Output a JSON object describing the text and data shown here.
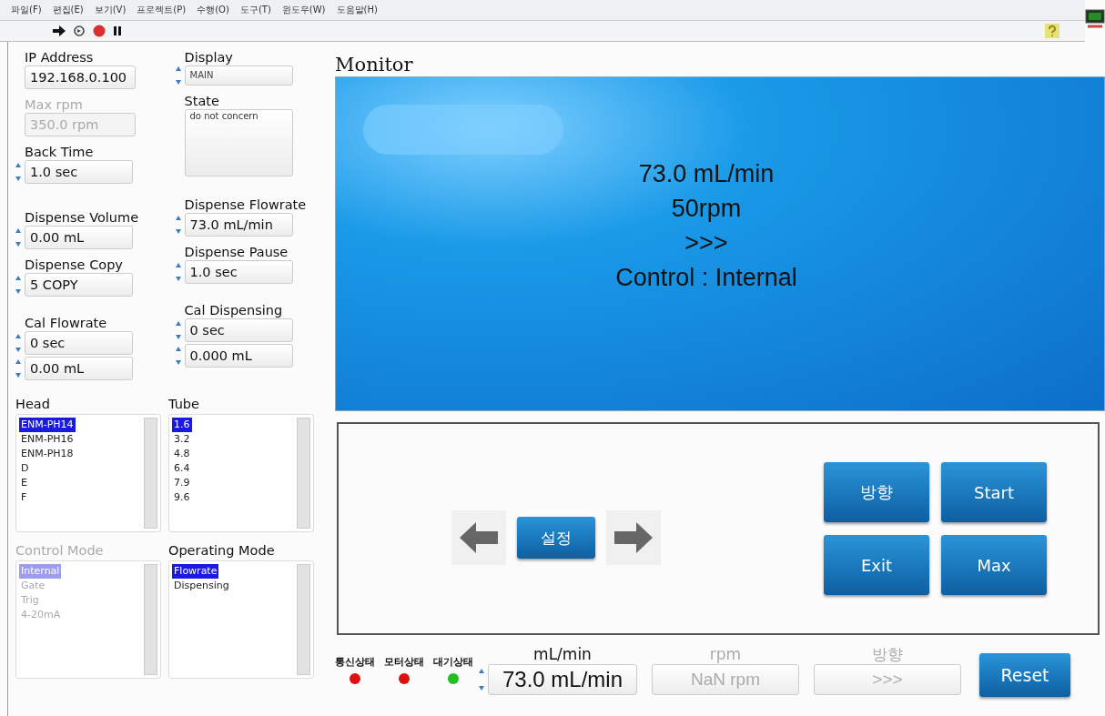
{
  "menu": [
    "파일(F)",
    "편집(E)",
    "보기(V)",
    "프로젝트(P)",
    "수행(O)",
    "도구(T)",
    "윈도우(W)",
    "도움말(H)"
  ],
  "left_column": [
    {
      "label": "IP Address",
      "kind": "text",
      "values": [
        "192.168.0.100"
      ],
      "disabled": false
    },
    {
      "label": "Max rpm",
      "kind": "text",
      "values": [
        "350.0 rpm"
      ],
      "disabled": true
    },
    {
      "label": "Back Time",
      "kind": "spin",
      "values": [
        "1.0 sec"
      ],
      "disabled": false
    },
    {
      "label": "Dispense Volume",
      "kind": "spin",
      "values": [
        "0.00 mL"
      ],
      "disabled": false
    },
    {
      "label": "Dispense Copy",
      "kind": "spin",
      "values": [
        "5 COPY"
      ],
      "disabled": false
    },
    {
      "label": "Cal Flowrate",
      "kind": "spin",
      "values": [
        "0 sec",
        "0.00 mL"
      ],
      "disabled": false
    }
  ],
  "right_column": [
    {
      "label": "Display",
      "kind": "small",
      "values": [
        "MAIN"
      ],
      "disabled": false
    },
    {
      "label": "State",
      "kind": "area",
      "values": [
        "do not concern"
      ],
      "disabled": false
    },
    {
      "label": "Dispense Flowrate",
      "kind": "spin",
      "values": [
        "73.0 mL/min"
      ],
      "disabled": false
    },
    {
      "label": "Dispense Pause",
      "kind": "spin",
      "values": [
        "1.0 sec"
      ],
      "disabled": false
    },
    {
      "label": "Cal Dispensing",
      "kind": "spin",
      "values": [
        "0 sec",
        "0.000 mL"
      ],
      "disabled": false
    }
  ],
  "lists": [
    {
      "label": "Head",
      "disabled": false,
      "items": [
        {
          "text": "ENM-PH14",
          "selected": true
        },
        {
          "text": "ENM-PH16",
          "selected": false
        },
        {
          "text": "ENM-PH18",
          "selected": false
        },
        {
          "text": "D",
          "selected": false
        },
        {
          "text": "E",
          "selected": false
        },
        {
          "text": "F",
          "selected": false
        }
      ]
    },
    {
      "label": "Tube",
      "disabled": false,
      "items": [
        {
          "text": "1.6",
          "selected": true
        },
        {
          "text": "3.2",
          "selected": false
        },
        {
          "text": "4.8",
          "selected": false
        },
        {
          "text": "6.4",
          "selected": false
        },
        {
          "text": "7.9",
          "selected": false
        },
        {
          "text": "9.6",
          "selected": false
        }
      ]
    },
    {
      "label": "Control Mode",
      "disabled": true,
      "items": [
        {
          "text": "Internal",
          "selected": true
        },
        {
          "text": "Gate",
          "selected": false
        },
        {
          "text": "Trig",
          "selected": false
        },
        {
          "text": "4-20mA",
          "selected": false
        }
      ]
    },
    {
      "label": "Operating Mode",
      "disabled": false,
      "items": [
        {
          "text": "Flowrate",
          "selected": true
        },
        {
          "text": "Dispensing",
          "selected": false
        }
      ]
    }
  ],
  "monitor": {
    "title": "Monitor",
    "lines": [
      "73.0 mL/min",
      "50rpm",
      ">>>",
      "Control : Internal"
    ]
  },
  "nav_button": "설정",
  "buttons": [
    "방향",
    "Start",
    "Exit",
    "Max"
  ],
  "indicators": [
    {
      "label": "통신상태",
      "color": "#e01010"
    },
    {
      "label": "모터상태",
      "color": "#e01010"
    },
    {
      "label": "대기상태",
      "color": "#20c020"
    }
  ],
  "readouts": [
    {
      "label": "mL/min",
      "value": "73.0 mL/min",
      "disabled": false
    },
    {
      "label": "rpm",
      "value": "NaN rpm",
      "disabled": true
    },
    {
      "label": "방향",
      "value": ">>>",
      "disabled": true
    }
  ],
  "reset_button": "Reset"
}
